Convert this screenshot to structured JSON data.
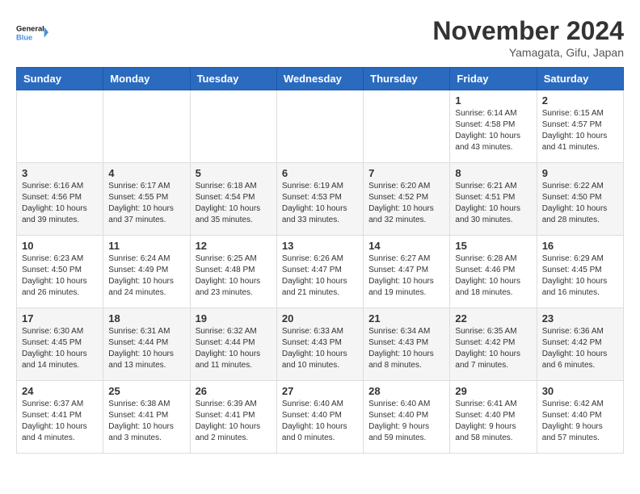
{
  "header": {
    "logo_line1": "General",
    "logo_line2": "Blue",
    "month_title": "November 2024",
    "location": "Yamagata, Gifu, Japan"
  },
  "weekdays": [
    "Sunday",
    "Monday",
    "Tuesday",
    "Wednesday",
    "Thursday",
    "Friday",
    "Saturday"
  ],
  "weeks": [
    [
      {
        "day": "",
        "detail": ""
      },
      {
        "day": "",
        "detail": ""
      },
      {
        "day": "",
        "detail": ""
      },
      {
        "day": "",
        "detail": ""
      },
      {
        "day": "",
        "detail": ""
      },
      {
        "day": "1",
        "detail": "Sunrise: 6:14 AM\nSunset: 4:58 PM\nDaylight: 10 hours\nand 43 minutes."
      },
      {
        "day": "2",
        "detail": "Sunrise: 6:15 AM\nSunset: 4:57 PM\nDaylight: 10 hours\nand 41 minutes."
      }
    ],
    [
      {
        "day": "3",
        "detail": "Sunrise: 6:16 AM\nSunset: 4:56 PM\nDaylight: 10 hours\nand 39 minutes."
      },
      {
        "day": "4",
        "detail": "Sunrise: 6:17 AM\nSunset: 4:55 PM\nDaylight: 10 hours\nand 37 minutes."
      },
      {
        "day": "5",
        "detail": "Sunrise: 6:18 AM\nSunset: 4:54 PM\nDaylight: 10 hours\nand 35 minutes."
      },
      {
        "day": "6",
        "detail": "Sunrise: 6:19 AM\nSunset: 4:53 PM\nDaylight: 10 hours\nand 33 minutes."
      },
      {
        "day": "7",
        "detail": "Sunrise: 6:20 AM\nSunset: 4:52 PM\nDaylight: 10 hours\nand 32 minutes."
      },
      {
        "day": "8",
        "detail": "Sunrise: 6:21 AM\nSunset: 4:51 PM\nDaylight: 10 hours\nand 30 minutes."
      },
      {
        "day": "9",
        "detail": "Sunrise: 6:22 AM\nSunset: 4:50 PM\nDaylight: 10 hours\nand 28 minutes."
      }
    ],
    [
      {
        "day": "10",
        "detail": "Sunrise: 6:23 AM\nSunset: 4:50 PM\nDaylight: 10 hours\nand 26 minutes."
      },
      {
        "day": "11",
        "detail": "Sunrise: 6:24 AM\nSunset: 4:49 PM\nDaylight: 10 hours\nand 24 minutes."
      },
      {
        "day": "12",
        "detail": "Sunrise: 6:25 AM\nSunset: 4:48 PM\nDaylight: 10 hours\nand 23 minutes."
      },
      {
        "day": "13",
        "detail": "Sunrise: 6:26 AM\nSunset: 4:47 PM\nDaylight: 10 hours\nand 21 minutes."
      },
      {
        "day": "14",
        "detail": "Sunrise: 6:27 AM\nSunset: 4:47 PM\nDaylight: 10 hours\nand 19 minutes."
      },
      {
        "day": "15",
        "detail": "Sunrise: 6:28 AM\nSunset: 4:46 PM\nDaylight: 10 hours\nand 18 minutes."
      },
      {
        "day": "16",
        "detail": "Sunrise: 6:29 AM\nSunset: 4:45 PM\nDaylight: 10 hours\nand 16 minutes."
      }
    ],
    [
      {
        "day": "17",
        "detail": "Sunrise: 6:30 AM\nSunset: 4:45 PM\nDaylight: 10 hours\nand 14 minutes."
      },
      {
        "day": "18",
        "detail": "Sunrise: 6:31 AM\nSunset: 4:44 PM\nDaylight: 10 hours\nand 13 minutes."
      },
      {
        "day": "19",
        "detail": "Sunrise: 6:32 AM\nSunset: 4:44 PM\nDaylight: 10 hours\nand 11 minutes."
      },
      {
        "day": "20",
        "detail": "Sunrise: 6:33 AM\nSunset: 4:43 PM\nDaylight: 10 hours\nand 10 minutes."
      },
      {
        "day": "21",
        "detail": "Sunrise: 6:34 AM\nSunset: 4:43 PM\nDaylight: 10 hours\nand 8 minutes."
      },
      {
        "day": "22",
        "detail": "Sunrise: 6:35 AM\nSunset: 4:42 PM\nDaylight: 10 hours\nand 7 minutes."
      },
      {
        "day": "23",
        "detail": "Sunrise: 6:36 AM\nSunset: 4:42 PM\nDaylight: 10 hours\nand 6 minutes."
      }
    ],
    [
      {
        "day": "24",
        "detail": "Sunrise: 6:37 AM\nSunset: 4:41 PM\nDaylight: 10 hours\nand 4 minutes."
      },
      {
        "day": "25",
        "detail": "Sunrise: 6:38 AM\nSunset: 4:41 PM\nDaylight: 10 hours\nand 3 minutes."
      },
      {
        "day": "26",
        "detail": "Sunrise: 6:39 AM\nSunset: 4:41 PM\nDaylight: 10 hours\nand 2 minutes."
      },
      {
        "day": "27",
        "detail": "Sunrise: 6:40 AM\nSunset: 4:40 PM\nDaylight: 10 hours\nand 0 minutes."
      },
      {
        "day": "28",
        "detail": "Sunrise: 6:40 AM\nSunset: 4:40 PM\nDaylight: 9 hours\nand 59 minutes."
      },
      {
        "day": "29",
        "detail": "Sunrise: 6:41 AM\nSunset: 4:40 PM\nDaylight: 9 hours\nand 58 minutes."
      },
      {
        "day": "30",
        "detail": "Sunrise: 6:42 AM\nSunset: 4:40 PM\nDaylight: 9 hours\nand 57 minutes."
      }
    ]
  ]
}
